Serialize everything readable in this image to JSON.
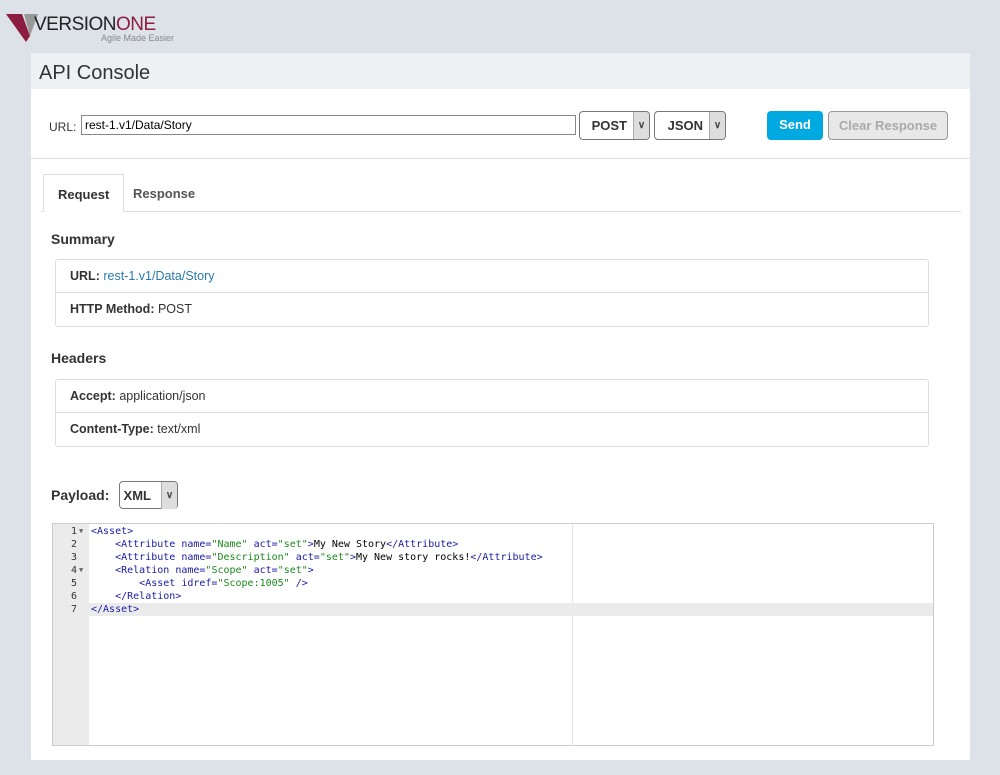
{
  "logo": {
    "text": "VERSIONONE",
    "tagline": "Agile Made Easier"
  },
  "title": "API Console",
  "url_bar": {
    "label": "URL:",
    "value": "rest-1.v1/Data/Story",
    "method": "POST",
    "format": "JSON",
    "send": "Send",
    "clear": "Clear Response"
  },
  "tabs": [
    {
      "label": "Request",
      "active": true
    },
    {
      "label": "Response",
      "active": false
    }
  ],
  "summary": {
    "heading": "Summary",
    "rows": [
      {
        "key": "URL:",
        "value": "rest-1.v1/Data/Story"
      },
      {
        "key": "HTTP Method:",
        "value": "POST"
      }
    ]
  },
  "headers": {
    "heading": "Headers",
    "rows": [
      {
        "key": "Accept:",
        "value": "application/json"
      },
      {
        "key": "Content-Type:",
        "value": "text/xml"
      }
    ]
  },
  "payload": {
    "label": "Payload:",
    "format": "XML",
    "lines": [
      {
        "n": "1",
        "fold": true,
        "parts": [
          [
            "tg",
            "<Asset>"
          ]
        ]
      },
      {
        "n": "2",
        "parts": [
          [
            "tx",
            "    "
          ],
          [
            "tg",
            "<Attribute "
          ],
          [
            "at",
            "name="
          ],
          [
            "vl",
            "\"Name\""
          ],
          [
            "at",
            " act="
          ],
          [
            "vl",
            "\"set\""
          ],
          [
            "tg",
            ">"
          ],
          [
            "tx",
            "My New Story"
          ],
          [
            "tg",
            "</Attribute>"
          ]
        ]
      },
      {
        "n": "3",
        "parts": [
          [
            "tx",
            "    "
          ],
          [
            "tg",
            "<Attribute "
          ],
          [
            "at",
            "name="
          ],
          [
            "vl",
            "\"Description\""
          ],
          [
            "at",
            " act="
          ],
          [
            "vl",
            "\"set\""
          ],
          [
            "tg",
            ">"
          ],
          [
            "tx",
            "My New story rocks!"
          ],
          [
            "tg",
            "</Attribute>"
          ]
        ]
      },
      {
        "n": "4",
        "fold": true,
        "parts": [
          [
            "tx",
            "    "
          ],
          [
            "tg",
            "<Relation "
          ],
          [
            "at",
            "name="
          ],
          [
            "vl",
            "\"Scope\""
          ],
          [
            "at",
            " act="
          ],
          [
            "vl",
            "\"set\""
          ],
          [
            "tg",
            ">"
          ]
        ]
      },
      {
        "n": "5",
        "parts": [
          [
            "tx",
            "        "
          ],
          [
            "tg",
            "<Asset "
          ],
          [
            "at",
            "idref="
          ],
          [
            "vl",
            "\"Scope:1005\""
          ],
          [
            "tg",
            " />"
          ]
        ]
      },
      {
        "n": "6",
        "parts": [
          [
            "tx",
            "    "
          ],
          [
            "tg",
            "</Relation>"
          ]
        ]
      },
      {
        "n": "7",
        "current": true,
        "parts": [
          [
            "tg",
            "</Asset>"
          ]
        ]
      }
    ]
  },
  "colors": {
    "accent": "#00a9e0",
    "brand": "#8c1d40",
    "link": "#2a7ab0"
  }
}
